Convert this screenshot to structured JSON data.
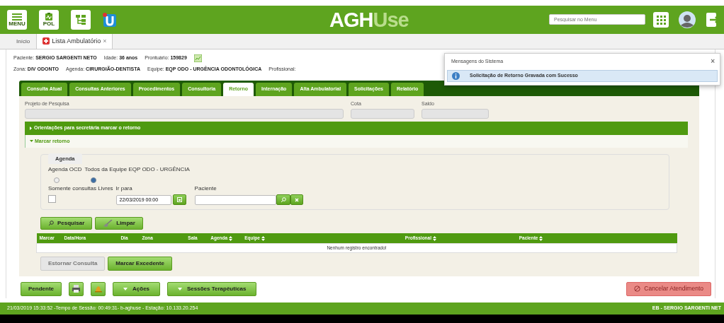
{
  "header": {
    "menu_label": "MENU",
    "pol_label": "POL",
    "logo_primary": "AGH",
    "logo_secondary": "Use",
    "search": {
      "placeholder": "Pesquisar no Menu"
    }
  },
  "page_tabs": [
    {
      "label": "Início",
      "selected": false
    },
    {
      "label": "Lista Ambulatório",
      "selected": true,
      "close": "×"
    }
  ],
  "patient_info": [
    [
      {
        "label": "Paciente:",
        "value": "SERGIO SARGENTI NETO"
      },
      {
        "label": "Idade:",
        "value": "36 anos"
      },
      {
        "label": "Prontuário:",
        "value": "159829"
      }
    ],
    [
      {
        "label": "Zona:",
        "value": "DIV ODONTO"
      },
      {
        "label": "Agenda:",
        "value": "CIRURGIÃO-DENTISTA"
      },
      {
        "label": "Equipe:",
        "value": "EQP ODO - URGÊNCIA ODONTOLÓGICA"
      },
      {
        "label": "Profissional:"
      }
    ]
  ],
  "tabs": [
    {
      "label": "Consulta Atual",
      "selected": false
    },
    {
      "label": "Consultas Anteriores",
      "selected": false
    },
    {
      "label": "Procedimentos",
      "selected": false
    },
    {
      "label": "Consultoria",
      "selected": false
    },
    {
      "label": "Retorno",
      "selected": true
    },
    {
      "label": "Internação",
      "selected": false
    },
    {
      "label": "Alta Ambulatorial",
      "selected": false
    },
    {
      "label": "Solicitações",
      "selected": false
    },
    {
      "label": "Relatório",
      "selected": false
    }
  ],
  "research_fields": [
    {
      "label": "Projeto de Pesquisa"
    },
    {
      "label": "Cota"
    },
    {
      "label": "Saldo"
    }
  ],
  "accordions": [
    {
      "label": "Orientações para secretária marcar o retorno",
      "expanded": false
    },
    {
      "label": "Marcar retorno",
      "expanded": true
    }
  ],
  "agenda": {
    "legend": "Agenda",
    "options": [
      {
        "label": "Agenda OCD",
        "selected": false
      },
      {
        "label": "Todos da Equipe EQP ODO - URGÊNCIA",
        "selected": true
      }
    ],
    "free_only": {
      "label": "Somente consultas Livres",
      "checked": false
    },
    "go_to": {
      "label": "Ir para",
      "value": "22/03/2019 00:00"
    },
    "patient": {
      "label": "Paciente"
    }
  },
  "search_buttons": [
    {
      "label": "Pesquisar",
      "kind": "search"
    },
    {
      "label": "Limpar",
      "kind": "clear"
    }
  ],
  "table": {
    "columns": [
      {
        "label": "Marcar",
        "sortable": false
      },
      {
        "label": "Data/Hora",
        "sortable": false
      },
      {
        "label": "Dia",
        "sortable": false
      },
      {
        "label": "Zona",
        "sortable": false
      },
      {
        "label": "Sala",
        "sortable": false
      },
      {
        "label": "Agenda",
        "sortable": true
      },
      {
        "label": "Equipe",
        "sortable": true
      },
      {
        "label": "Profissional",
        "sortable": true
      },
      {
        "label": "Paciente",
        "sortable": true
      }
    ],
    "empty_message": "Nenhum registro encontrado!"
  },
  "action_buttons": [
    {
      "label": "Estornar Consulta",
      "disabled": true
    },
    {
      "label": "Marcar Excedente",
      "disabled": false
    }
  ],
  "footer_buttons": [
    {
      "kind": "text",
      "label": "Pendente"
    },
    {
      "kind": "printer"
    },
    {
      "kind": "alert"
    },
    {
      "kind": "dropdown",
      "label": "Ações"
    },
    {
      "kind": "dropdown",
      "label": "Sessões Terapêuticas"
    },
    {
      "kind": "danger",
      "label": "Cancelar Atendimento"
    }
  ],
  "message": {
    "title": "Mensagens do Sistema",
    "close": "×",
    "text": "Solicitação de Retorno Gravada com Sucesso"
  },
  "status_bar": {
    "left": "21/03/2019 15:33:52 -Tempo de Sessão: 00:49:31- b-aghuse - Estação: 10.133.20.254",
    "right": "EB - SERGIO SARGENTI NET"
  }
}
